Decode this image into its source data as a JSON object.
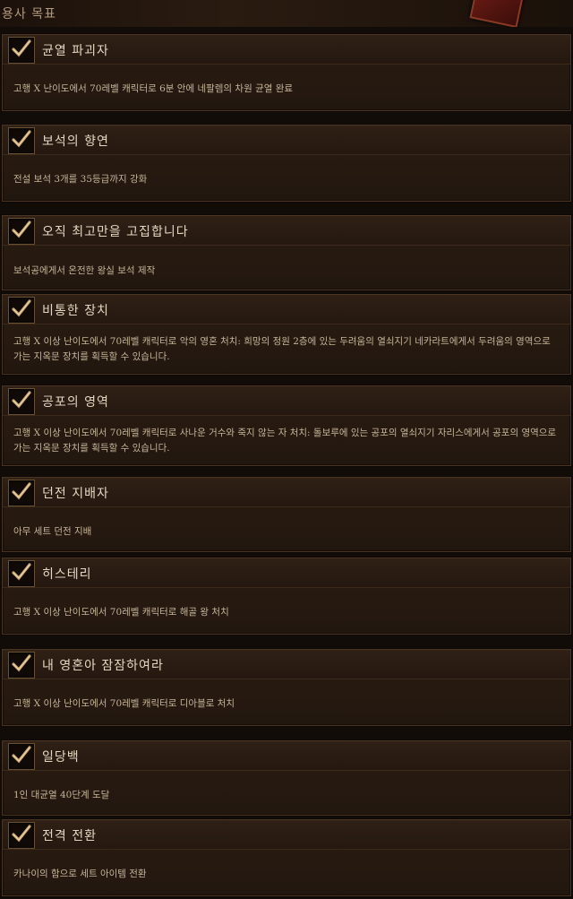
{
  "section": {
    "title": "용사 목표"
  },
  "achievements": [
    {
      "name": "균열 파괴자",
      "description": "고행 X 난이도에서 70레벨 캐릭터로 6분 안에 네팔렘의 차원 균열 완료",
      "completed": true
    },
    {
      "name": "보석의 향연",
      "description": "전설 보석 3개를 35등급까지 강화",
      "completed": true
    },
    {
      "name": "오직 최고만을 고집합니다",
      "description": "보석공에게서 온전한 왕실 보석 제작",
      "completed": true
    },
    {
      "name": "비통한 장치",
      "description": "고행 X 이상 난이도에서 70레벨 캐릭터로 악의 영혼 처치: 희망의 정원 2층에 있는 두려움의 열쇠지기 네카라트에게서 두려움의 영역으로 가는 지옥문 장치를 획득할 수 있습니다.",
      "completed": true
    },
    {
      "name": "공포의 영역",
      "description": "고행 X 이상 난이도에서 70레벨 캐릭터로 사나운 거수와 죽지 않는 자 처치: 돌보루에 있는 공포의 열쇠지기 자리스에게서 공포의 영역으로 가는 지옥문 장치를 획득할 수 있습니다.",
      "completed": true
    },
    {
      "name": "던전 지배자",
      "description": "아무 세트 던전 지배",
      "completed": true
    },
    {
      "name": "히스테리",
      "description": "고행 X 이상 난이도에서 70레벨 캐릭터로 해골 왕 처치",
      "completed": true
    },
    {
      "name": "내 영혼아 잠잠하여라",
      "description": "고행 X 이상 난이도에서 70레벨 캐릭터로 디아블로 처치",
      "completed": true
    },
    {
      "name": "일당백",
      "description": "1인 대균열 40단계 도달",
      "completed": true
    },
    {
      "name": "전격 전환",
      "description": "카나이의 함으로 세트 아이템 전환",
      "completed": true
    }
  ],
  "colors": {
    "check": "#c9a46a",
    "panel": "#2a1c12",
    "border": "#4a3422"
  },
  "icons": {
    "check": "checkmark-icon",
    "emblem": "crest-emblem-icon"
  }
}
